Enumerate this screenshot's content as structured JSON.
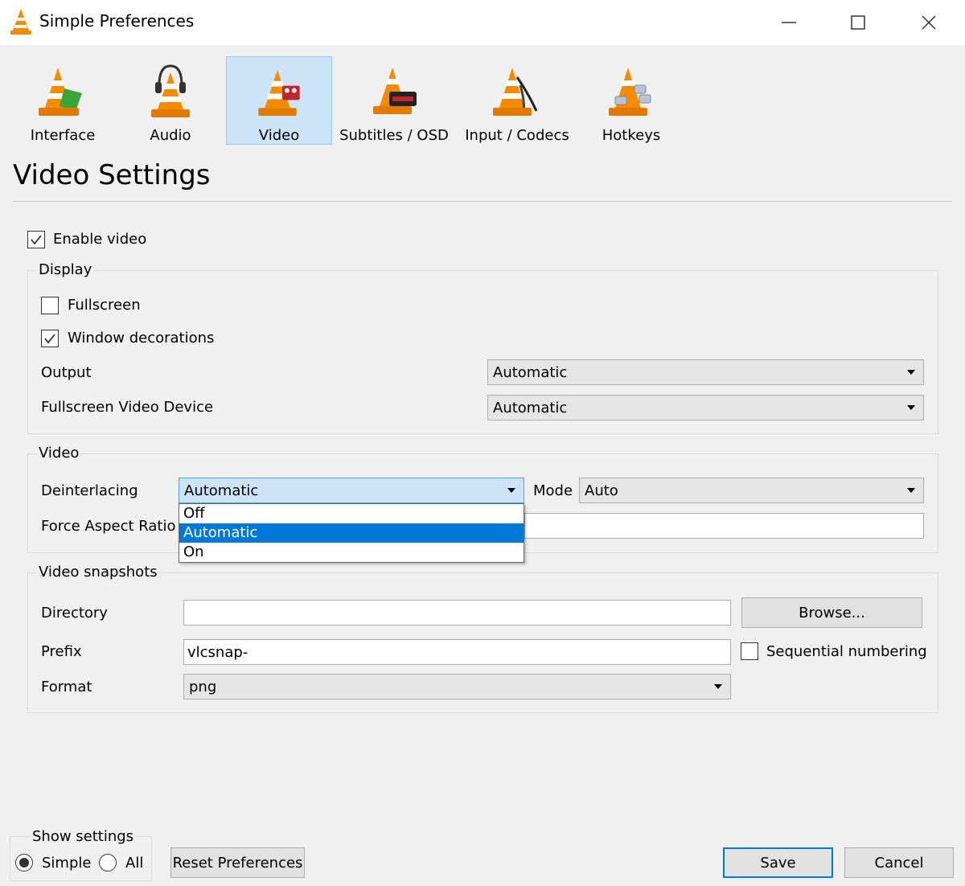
{
  "window": {
    "title": "Simple Preferences",
    "controls": [
      "minimize-icon",
      "maximize-icon",
      "close-icon"
    ]
  },
  "tabs": [
    {
      "label": "Interface",
      "icon": "vlc-cone-interface-icon",
      "active": false
    },
    {
      "label": "Audio",
      "icon": "vlc-cone-headphones-icon",
      "active": false
    },
    {
      "label": "Video",
      "icon": "vlc-cone-video-icon",
      "active": true
    },
    {
      "label": "Subtitles / OSD",
      "icon": "vlc-cone-subtitles-icon",
      "active": false
    },
    {
      "label": "Input / Codecs",
      "icon": "vlc-cone-codecs-icon",
      "active": false
    },
    {
      "label": "Hotkeys",
      "icon": "vlc-cone-hotkeys-icon",
      "active": false
    }
  ],
  "page_title": "Video Settings",
  "enable_video": {
    "label": "Enable video",
    "checked": true
  },
  "display": {
    "title": "Display",
    "fullscreen": {
      "label": "Fullscreen",
      "checked": false
    },
    "window_decorations": {
      "label": "Window decorations",
      "checked": true
    },
    "output": {
      "label": "Output",
      "value": "Automatic"
    },
    "fullscreen_device": {
      "label": "Fullscreen Video Device",
      "value": "Automatic"
    }
  },
  "video": {
    "title": "Video",
    "deinterlacing": {
      "label": "Deinterlacing",
      "value": "Automatic",
      "options": [
        "Off",
        "Automatic",
        "On"
      ],
      "selected_option": "Automatic"
    },
    "mode": {
      "label": "Mode",
      "value": "Auto"
    },
    "force_aspect_ratio": {
      "label": "Force Aspect Ratio",
      "value": ""
    }
  },
  "snapshots": {
    "title": "Video snapshots",
    "directory": {
      "label": "Directory",
      "value": ""
    },
    "browse_label": "Browse...",
    "prefix": {
      "label": "Prefix",
      "value": "vlcsnap-"
    },
    "sequential": {
      "label": "Sequential numbering",
      "checked": false
    },
    "format": {
      "label": "Format",
      "value": "png"
    }
  },
  "footer": {
    "show_settings_title": "Show settings",
    "simple_label": "Simple",
    "all_label": "All",
    "selected": "Simple",
    "reset_label": "Reset Preferences",
    "save_label": "Save",
    "cancel_label": "Cancel"
  },
  "colors": {
    "window_bg": "#f0f0f0",
    "accent": "#0078d7",
    "tab_active_bg": "#cce4f7",
    "vlc_orange": "#f48b00"
  }
}
